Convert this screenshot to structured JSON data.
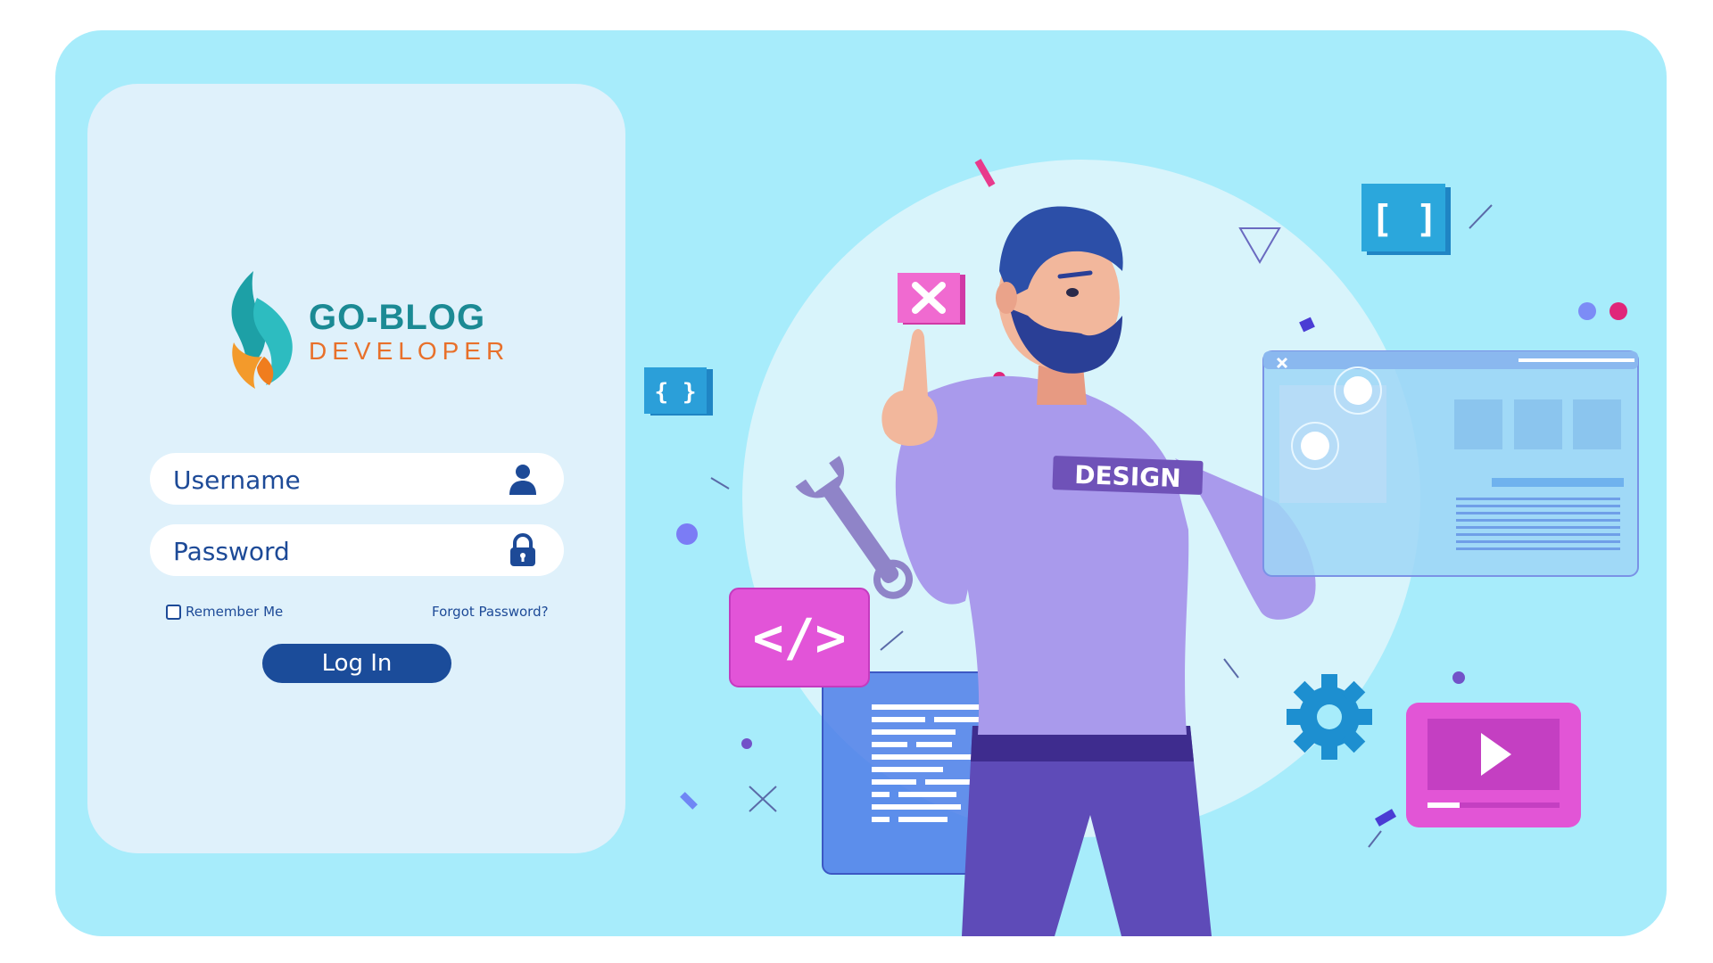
{
  "brand": {
    "title": "GO-BLOG",
    "subtitle": "DEVELOPER"
  },
  "login": {
    "username_placeholder": "Username",
    "password_placeholder": "Password",
    "remember_label": "Remember Me",
    "forgot_label": "Forgot Password?",
    "login_label": "Log In"
  },
  "illustration": {
    "shirt_text": "DESIGN",
    "code_brackets": "</>",
    "bracket_icon_small": "{ }",
    "bracket_icon_large": "[ ]"
  },
  "colors": {
    "background": "#a7ecfb",
    "panel": "#dff1fb",
    "primary": "#1b4c9a",
    "brand_teal": "#1b8a94",
    "brand_orange": "#e8702a"
  },
  "icons": [
    "user-icon",
    "lock-icon",
    "checkbox-icon",
    "flame-logo-icon"
  ]
}
